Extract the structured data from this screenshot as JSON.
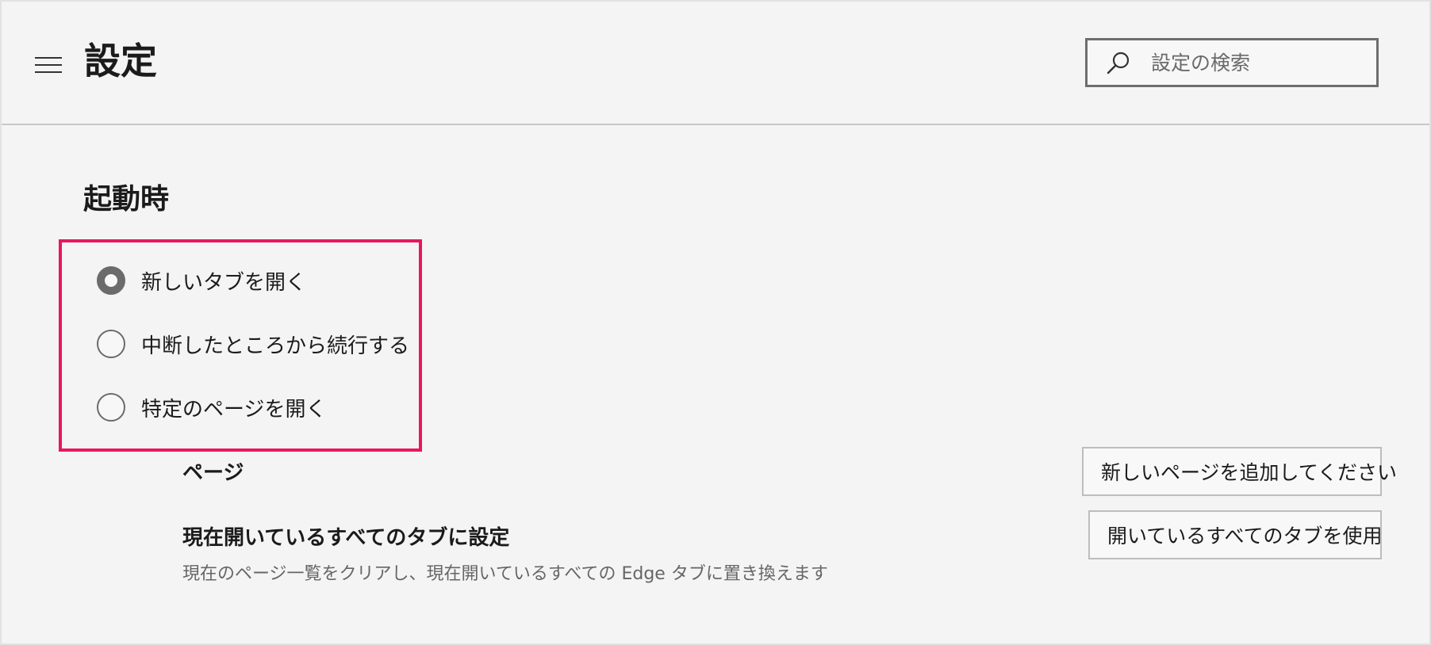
{
  "header": {
    "title": "設定",
    "search": {
      "placeholder": "設定の検索",
      "value": ""
    }
  },
  "startup": {
    "section_title": "起動時",
    "options": [
      {
        "label": "新しいタブを開く",
        "selected": true
      },
      {
        "label": "中断したところから続行する",
        "selected": false
      },
      {
        "label": "特定のページを開く",
        "selected": false
      }
    ],
    "pages_label": "ページ",
    "add_page_button": "新しいページを追加してください",
    "use_open_tabs": {
      "title": "現在開いているすべてのタブに設定",
      "description": "現在のページ一覧をクリアし、現在開いているすべての Edge タブに置き換えます",
      "button": "開いているすべてのタブを使用"
    }
  },
  "colors": {
    "highlight": "#e8175d",
    "background": "#f4f4f4",
    "radio": "#6b6b6b"
  }
}
